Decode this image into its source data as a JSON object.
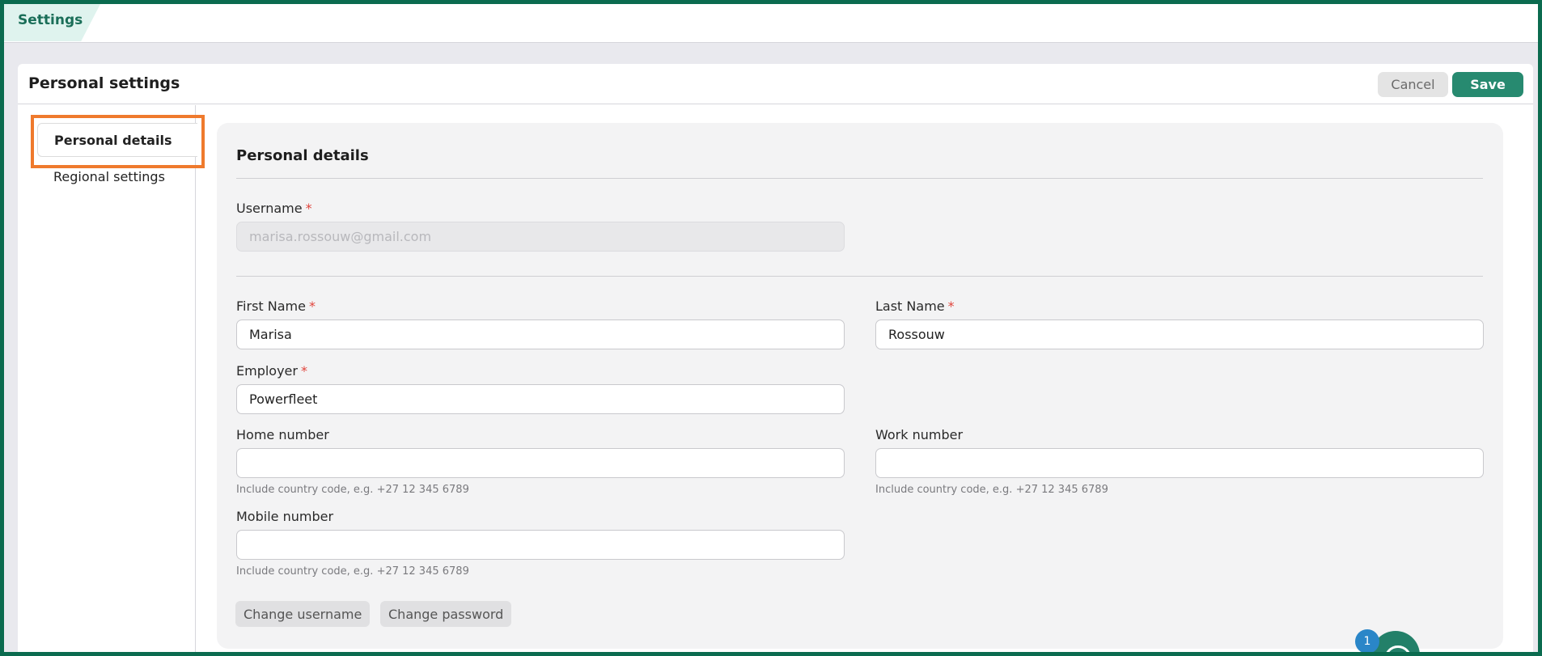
{
  "topbar": {
    "tab_label": "Settings"
  },
  "card": {
    "title": "Personal settings",
    "cancel_label": "Cancel",
    "save_label": "Save"
  },
  "sidebar": {
    "items": [
      {
        "label": "Personal details",
        "active": true
      },
      {
        "label": "Regional settings",
        "active": false
      }
    ]
  },
  "form": {
    "section_title": "Personal details",
    "required_mark": "*",
    "username": {
      "label": "Username",
      "value": "marisa.rossouw@gmail.com"
    },
    "first_name": {
      "label": "First Name",
      "value": "Marisa"
    },
    "last_name": {
      "label": "Last Name",
      "value": "Rossouw"
    },
    "employer": {
      "label": "Employer",
      "value": "Powerfleet"
    },
    "home_number": {
      "label": "Home number",
      "value": "",
      "hint": "Include country code, e.g. +27 12 345 6789"
    },
    "work_number": {
      "label": "Work number",
      "value": "",
      "hint": "Include country code, e.g. +27 12 345 6789"
    },
    "mobile_number": {
      "label": "Mobile number",
      "value": "",
      "hint": "Include country code, e.g. +27 12 345 6789"
    },
    "change_username_label": "Change username",
    "change_password_label": "Change password"
  },
  "help": {
    "badge_count": "1"
  },
  "colors": {
    "brand": "#278a70",
    "frame": "#0b6b4f",
    "highlight": "#ef7a2d",
    "required": "#e0443c",
    "badge": "#2a86c8"
  }
}
